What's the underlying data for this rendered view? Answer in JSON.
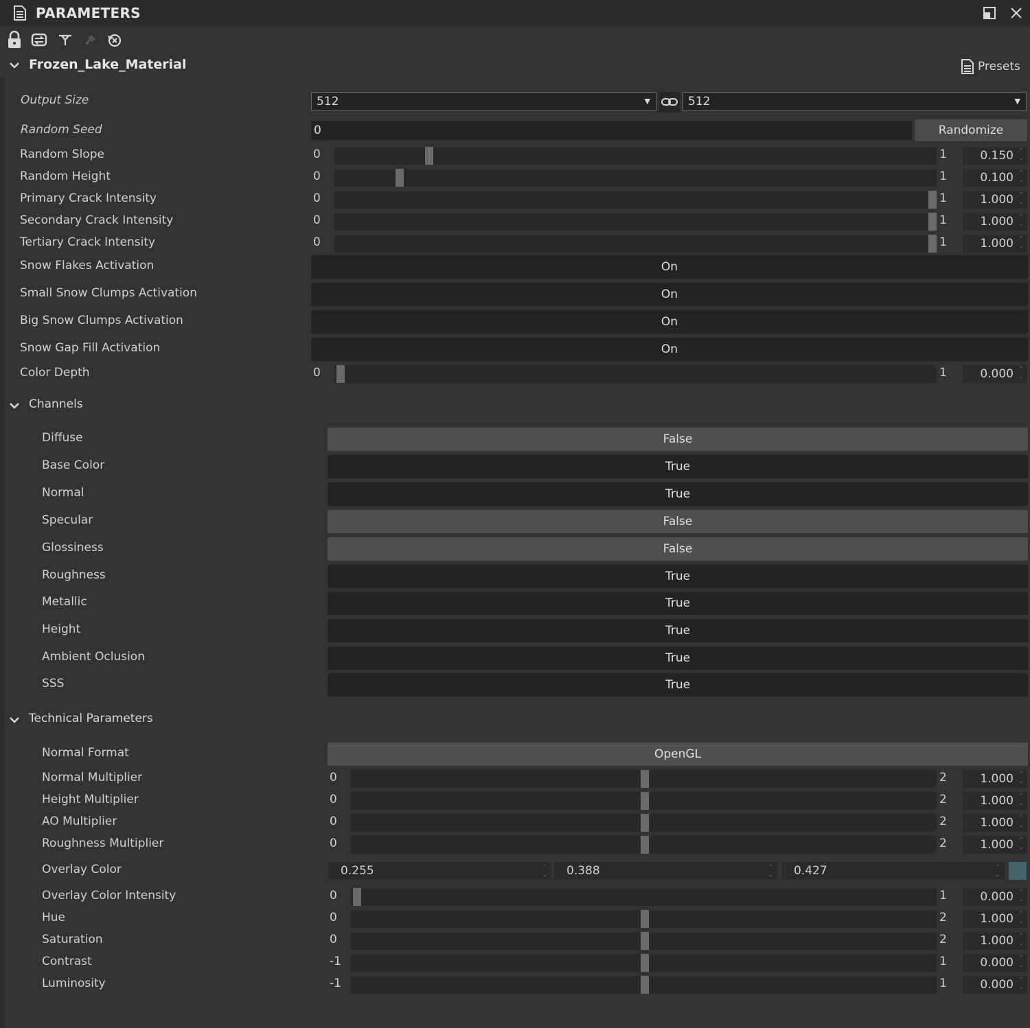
{
  "panel": {
    "title": "PARAMETERS",
    "material_name": "Frozen_Lake_Material",
    "presets_label": "Presets"
  },
  "output_size": {
    "label": "Output Size",
    "width": "512",
    "height": "512"
  },
  "random_seed": {
    "label": "Random Seed",
    "value": "0",
    "randomize_label": "Randomize"
  },
  "sliders": [
    {
      "label": "Random Slope",
      "min": "0",
      "max": "1",
      "value": "0.150",
      "fraction": 0.15
    },
    {
      "label": "Random Height",
      "min": "0",
      "max": "1",
      "value": "0.100",
      "fraction": 0.1
    },
    {
      "label": "Primary Crack Intensity",
      "min": "0",
      "max": "1",
      "value": "1.000",
      "fraction": 1.0
    },
    {
      "label": "Secondary Crack Intensity",
      "min": "0",
      "max": "1",
      "value": "1.000",
      "fraction": 1.0
    },
    {
      "label": "Tertiary Crack Intensity",
      "min": "0",
      "max": "1",
      "value": "1.000",
      "fraction": 1.0
    }
  ],
  "activations": [
    {
      "label": "Snow Flakes Activation",
      "value": "On"
    },
    {
      "label": "Small Snow Clumps Activation",
      "value": "On"
    },
    {
      "label": "Big Snow Clumps Activation",
      "value": "On"
    },
    {
      "label": "Snow Gap Fill Activation",
      "value": "On"
    }
  ],
  "color_depth": {
    "label": "Color Depth",
    "min": "0",
    "max": "1",
    "value": "0.000",
    "fraction": 0.0
  },
  "channels": {
    "title": "Channels",
    "items": [
      {
        "label": "Diffuse",
        "value": "False",
        "state": false
      },
      {
        "label": "Base Color",
        "value": "True",
        "state": true
      },
      {
        "label": "Normal",
        "value": "True",
        "state": true
      },
      {
        "label": "Specular",
        "value": "False",
        "state": false
      },
      {
        "label": "Glossiness",
        "value": "False",
        "state": false
      },
      {
        "label": "Roughness",
        "value": "True",
        "state": true
      },
      {
        "label": "Metallic",
        "value": "True",
        "state": true
      },
      {
        "label": "Height",
        "value": "True",
        "state": true
      },
      {
        "label": "Ambient Oclusion",
        "value": "True",
        "state": true
      },
      {
        "label": "SSS",
        "value": "True",
        "state": true
      }
    ]
  },
  "technical": {
    "title": "Technical Parameters",
    "normal_format": {
      "label": "Normal Format",
      "value": "OpenGL"
    },
    "multipliers": [
      {
        "label": "Normal Multiplier",
        "min": "0",
        "max": "2",
        "value": "1.000",
        "fraction": 0.5
      },
      {
        "label": "Height Multiplier",
        "min": "0",
        "max": "2",
        "value": "1.000",
        "fraction": 0.5
      },
      {
        "label": "AO Multiplier",
        "min": "0",
        "max": "2",
        "value": "1.000",
        "fraction": 0.5
      },
      {
        "label": "Roughness Multiplier",
        "min": "0",
        "max": "2",
        "value": "1.000",
        "fraction": 0.5
      }
    ],
    "overlay_color": {
      "label": "Overlay Color",
      "r": "0.255",
      "g": "0.388",
      "b": "0.427",
      "swatch": "#416369"
    },
    "adjustments": [
      {
        "label": "Overlay Color Intensity",
        "min": "0",
        "max": "1",
        "value": "0.000",
        "fraction": 0.0
      },
      {
        "label": "Hue",
        "min": "0",
        "max": "2",
        "value": "1.000",
        "fraction": 0.5
      },
      {
        "label": "Saturation",
        "min": "0",
        "max": "2",
        "value": "1.000",
        "fraction": 0.5
      },
      {
        "label": "Contrast",
        "min": "-1",
        "max": "1",
        "value": "0.000",
        "fraction": 0.5
      },
      {
        "label": "Luminosity",
        "min": "-1",
        "max": "1",
        "value": "0.000",
        "fraction": 0.5
      }
    ]
  },
  "colors": {
    "background": "#333333",
    "field": "#232323",
    "toggle_off": "#4f4f4f",
    "handle": "#6a6a6a"
  },
  "icons": [
    "document-icon",
    "maximize-icon",
    "close-icon",
    "lock-icon",
    "sync-icon",
    "filter-icon",
    "pin-icon",
    "reset-icon",
    "presets-icon",
    "link-icon",
    "chevron-down-icon"
  ]
}
